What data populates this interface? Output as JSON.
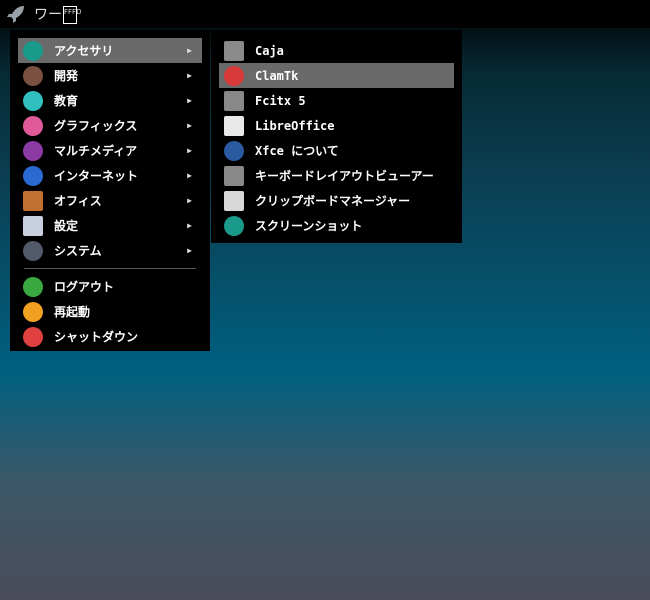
{
  "panel": {
    "title": "ワー",
    "glyph": "FFFD"
  },
  "main_menu": {
    "items": [
      {
        "label": "アクセサリ",
        "icon": "accessories-icon",
        "color": "#1a9a8a"
      },
      {
        "label": "開発",
        "icon": "development-icon",
        "color": "#7a5040"
      },
      {
        "label": "教育",
        "icon": "education-icon",
        "color": "#30c0c0"
      },
      {
        "label": "グラフィックス",
        "icon": "graphics-icon",
        "color": "#e05a9a"
      },
      {
        "label": "マルチメディア",
        "icon": "multimedia-icon",
        "color": "#8a3aa0"
      },
      {
        "label": "インターネット",
        "icon": "internet-icon",
        "color": "#2a6ad0"
      },
      {
        "label": "オフィス",
        "icon": "office-icon",
        "color": "#c07030"
      },
      {
        "label": "設定",
        "icon": "settings-icon",
        "color": "#c8d0e0"
      },
      {
        "label": "システム",
        "icon": "system-icon",
        "color": "#505a68"
      }
    ],
    "actions": [
      {
        "label": "ログアウト",
        "icon": "logout-icon",
        "color": "#3aa840"
      },
      {
        "label": "再起動",
        "icon": "restart-icon",
        "color": "#f0a020"
      },
      {
        "label": "シャットダウン",
        "icon": "shutdown-icon",
        "color": "#e04040"
      }
    ],
    "arrow": "▶"
  },
  "sub_menu": {
    "items": [
      {
        "label": "Caja",
        "icon": "caja-icon",
        "color": "#8a8a8a"
      },
      {
        "label": "ClamTk",
        "icon": "clamtk-icon",
        "color": "#d83a3a"
      },
      {
        "label": "Fcitx 5",
        "icon": "keyboard-icon",
        "color": "#888888"
      },
      {
        "label": "LibreOffice",
        "icon": "libreoffice-icon",
        "color": "#e8e8e8"
      },
      {
        "label": "Xfce について",
        "icon": "xfce-icon",
        "color": "#2a5aa0"
      },
      {
        "label": "キーボードレイアウトビューアー",
        "icon": "keyboard-icon",
        "color": "#888888"
      },
      {
        "label": "クリップボードマネージャー",
        "icon": "clipboard-icon",
        "color": "#d8d8d8"
      },
      {
        "label": "スクリーンショット",
        "icon": "screenshot-icon",
        "color": "#1a9a8a"
      }
    ]
  }
}
